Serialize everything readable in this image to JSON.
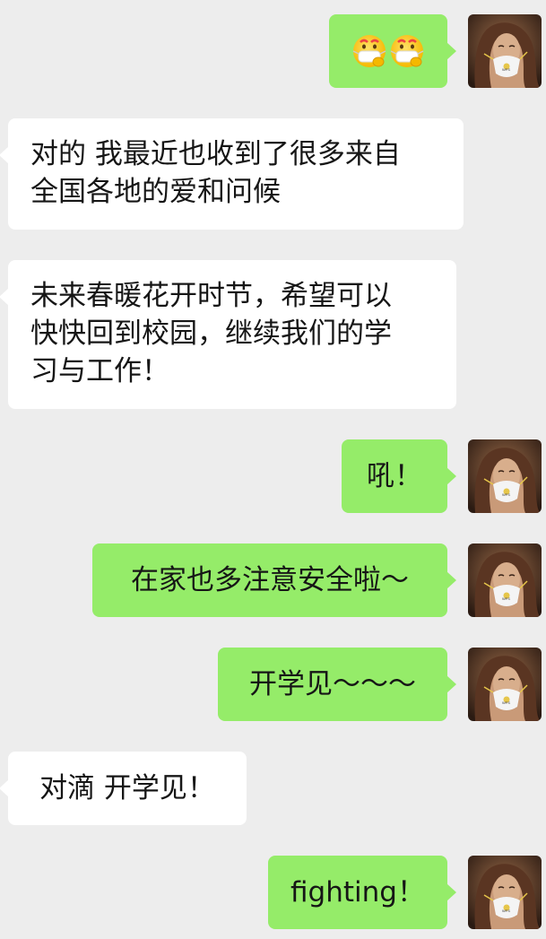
{
  "messages": [
    {
      "side": "me",
      "type": "emoji",
      "emoji": [
        "mask-face-emoji",
        "mask-face-emoji"
      ]
    },
    {
      "side": "them",
      "text": "对的 我最近也收到了很多来自全国各地的爱和问候",
      "lines": [
        "对的 我最近也收到了很多来自",
        "全国各地的爱和问候"
      ]
    },
    {
      "side": "them",
      "text": "未来春暖花开时节，希望可以快快回到校园，继续我们的学习与工作！",
      "lines": [
        "未来春暖花开时节，希望可以",
        "快快回到校园，继续我们的学",
        "习与工作！"
      ]
    },
    {
      "side": "me",
      "text": "吼！"
    },
    {
      "side": "me",
      "text": "在家也多注意安全啦～"
    },
    {
      "side": "me",
      "text": "开学见～～～"
    },
    {
      "side": "them",
      "text": "对滴 开学见！"
    },
    {
      "side": "me",
      "text": "fighting！"
    }
  ],
  "colors": {
    "background": "#ededed",
    "my_bubble": "#95ec69",
    "their_bubble": "#ffffff",
    "text": "#161616"
  },
  "avatar": {
    "icon": "masked-woman-avatar-icon"
  }
}
